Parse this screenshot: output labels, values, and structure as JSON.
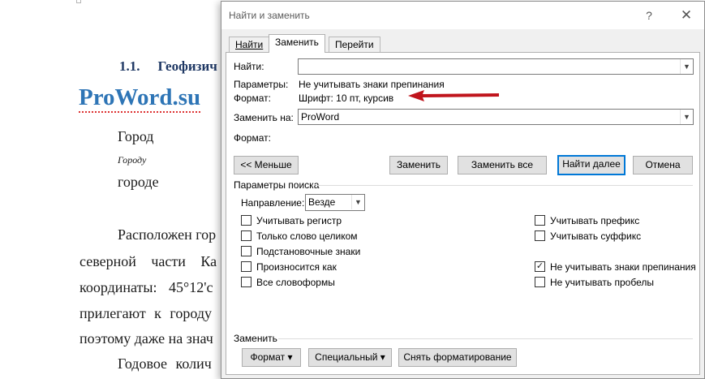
{
  "document": {
    "heading_number": "1.1.",
    "heading_text": "Геофизич",
    "proword": "ProWord.su",
    "lines": [
      "Город",
      "Городу",
      "городе",
      "Расположен гор",
      "северной части Ка",
      "координаты: 45°12'с",
      "прилегают к городу",
      "поэтому даже на знач",
      "Годовое колич"
    ]
  },
  "dialog": {
    "title": "Найти и заменить",
    "help": "?",
    "close": "✕",
    "tabs": [
      {
        "label": "Найти",
        "active": false
      },
      {
        "label": "Заменить",
        "active": true
      },
      {
        "label": "Перейти",
        "active": false
      }
    ],
    "find_label": "Найти:",
    "find_value": "",
    "params_label": "Параметры:",
    "params_value": "Не учитывать знаки препинания",
    "format_label": "Формат:",
    "format_value": "Шрифт: 10 пт, курсив",
    "replace_label": "Заменить на:",
    "replace_value": "ProWord",
    "replace_format_label": "Формат:",
    "buttons": {
      "less": "<< Меньше",
      "replace": "Заменить",
      "replace_all": "Заменить все",
      "find_next": "Найти далее",
      "cancel": "Отмена"
    },
    "search_params_title": "Параметры поиска",
    "direction_label": "Направление:",
    "direction_value": "Везде",
    "checkboxes_left": [
      {
        "label": "Учитывать регистр",
        "checked": false
      },
      {
        "label": "Только слово целиком",
        "checked": false
      },
      {
        "label": "Подстановочные знаки",
        "checked": false
      },
      {
        "label": "Произносится как",
        "checked": false
      },
      {
        "label": "Все словоформы",
        "checked": false
      }
    ],
    "checkboxes_right": [
      {
        "label": "Учитывать префикс",
        "checked": false
      },
      {
        "label": "Учитывать суффикс",
        "checked": false
      },
      {
        "label": "Не учитывать знаки препинания",
        "checked": true
      },
      {
        "label": "Не учитывать пробелы",
        "checked": false
      }
    ],
    "replace_section_title": "Заменить",
    "bottom_buttons": {
      "format": "Формат ▾",
      "special": "Специальный ▾",
      "clear_format": "Снять форматирование"
    }
  },
  "colors": {
    "annotation_arrow": "#c0141c",
    "accent": "#0078d7",
    "proword": "#2e75b6"
  },
  "icons": [
    "help-icon",
    "close-icon",
    "dropdown-arrow-icon",
    "checkmark-icon",
    "annotation-arrow-icon"
  ]
}
